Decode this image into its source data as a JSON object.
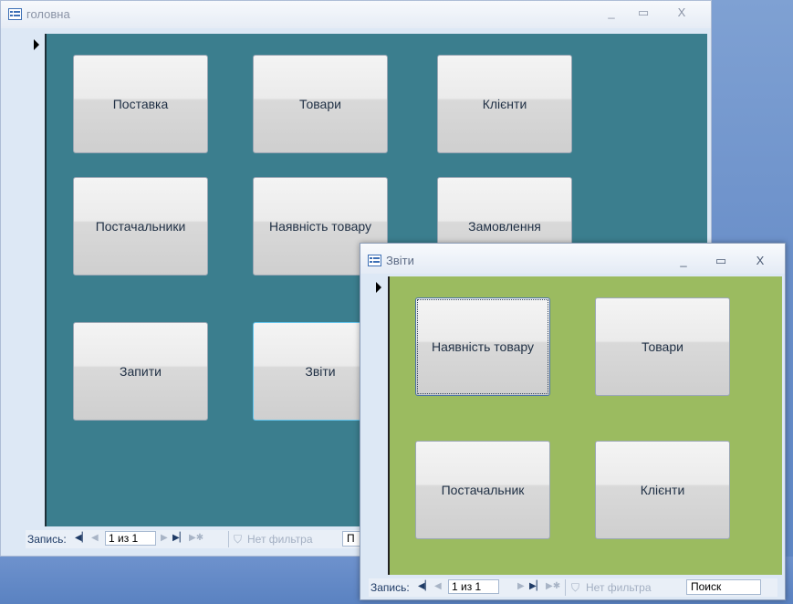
{
  "main_window": {
    "title": "головна",
    "controls": {
      "minimize": "_",
      "maximize": "▭",
      "close": "X"
    },
    "buttons": [
      "Поставка",
      "Товари",
      "Клієнти",
      "Постачальники",
      "Наявність товару",
      "Замовлення",
      "Запити",
      "Звіти"
    ],
    "background_color": "#3b7e8e",
    "navbar": {
      "record_label": "Запись:",
      "record_value": "1 из 1",
      "filter_label": "Нет фильтра",
      "search_partial": "П"
    }
  },
  "reports_window": {
    "title": "Звіти",
    "controls": {
      "minimize": "_",
      "maximize": "▭",
      "close": "X"
    },
    "buttons": [
      "Наявність товару",
      "Товари",
      "Постачальник",
      "Клієнти"
    ],
    "background_color": "#9bbb60",
    "navbar": {
      "record_label": "Запись:",
      "record_value": "1 из 1",
      "filter_label": "Нет фильтра",
      "search_value": "Поиск"
    }
  },
  "icons": [
    "form-icon",
    "record-selector-arrow-icon",
    "first-record-icon",
    "prev-record-icon",
    "next-record-icon",
    "last-record-icon",
    "new-record-icon",
    "filter-icon"
  ]
}
